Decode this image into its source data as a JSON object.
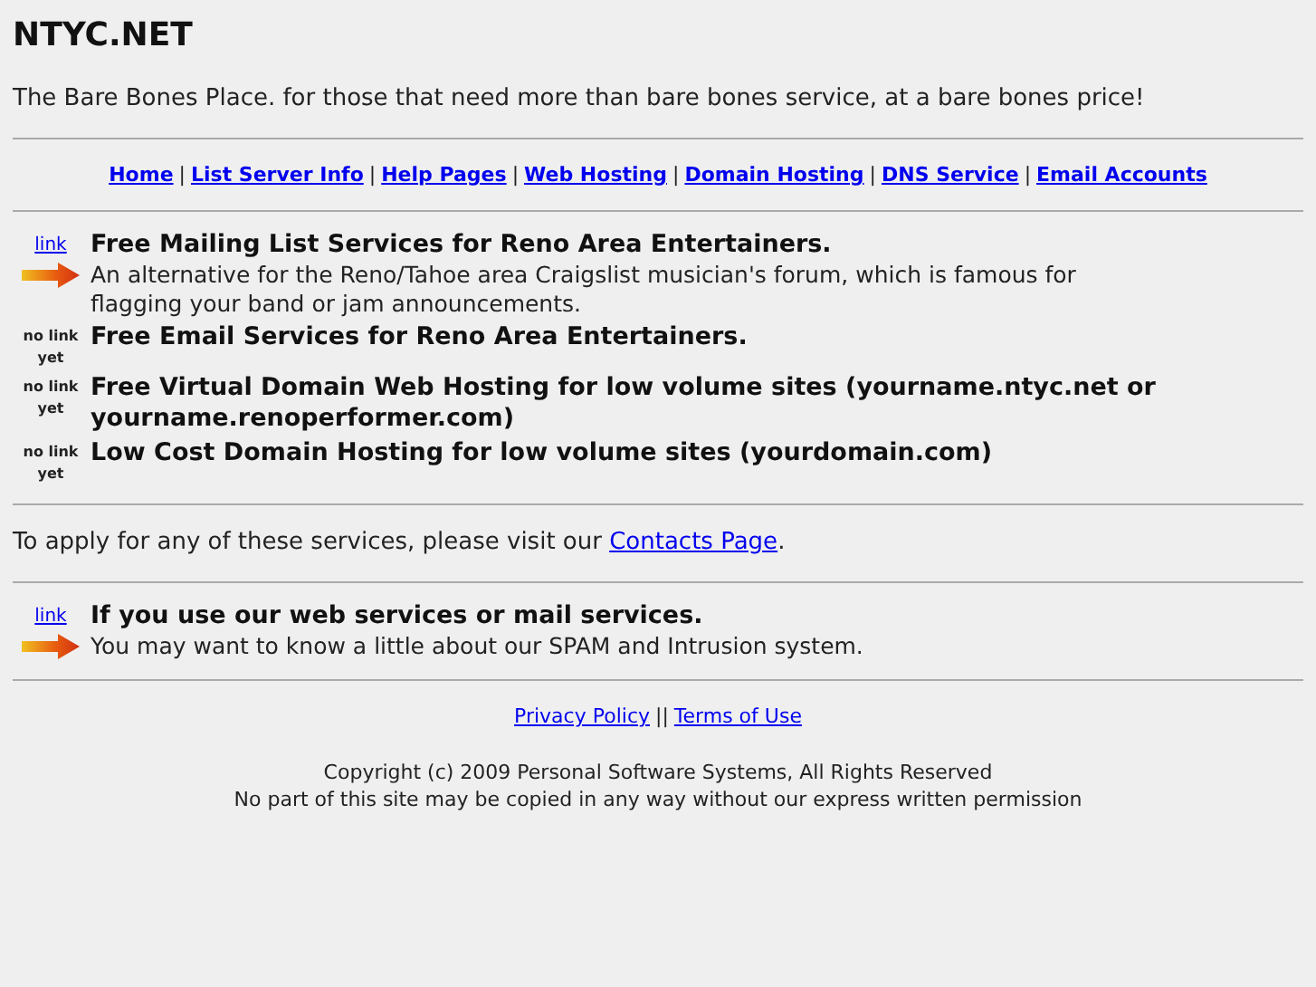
{
  "site_title": "NTYC.NET",
  "tagline": "The Bare Bones Place. for those that need more than bare bones service, at a bare bones price!",
  "nav": [
    "Home",
    "List Server Info",
    "Help Pages",
    "Web Hosting",
    "Domain Hosting",
    "DNS Service",
    "Email Accounts"
  ],
  "nav_separator": "|",
  "services": [
    {
      "kind": "link",
      "badge": "link",
      "title": "Free Mailing List Services for Reno Area Entertainers.",
      "description": "An alternative for the Reno/Tahoe area Craigslist musician's forum, which is famous for flagging your band or jam announcements."
    },
    {
      "kind": "nolink",
      "badge": "no link yet",
      "title": "Free Email Services for Reno Area Entertainers."
    },
    {
      "kind": "nolink",
      "badge": "no link yet",
      "title": "Free Virtual Domain Web Hosting for low volume sites (yourname.ntyc.net or yourname.renoperformer.com)"
    },
    {
      "kind": "nolink",
      "badge": "no link yet",
      "title": "Low Cost Domain Hosting for low volume sites (yourdomain.com)"
    }
  ],
  "apply": {
    "text_before": "To apply for any of these services, please visit our",
    "link": "Contacts Page",
    "text_after": "."
  },
  "notices": [
    {
      "kind": "link",
      "badge": "link",
      "title": "If you use our web services or mail services.",
      "description": "You may want to know a little about our SPAM and Intrusion system."
    }
  ],
  "footer_links": [
    "Privacy Policy",
    "Terms of Use"
  ],
  "footer_separator": "||",
  "copyright": "Copyright (c) 2009 Personal Software Systems, All Rights Reserved",
  "notice": "No part of this site may be copied in any way without our express written permission"
}
